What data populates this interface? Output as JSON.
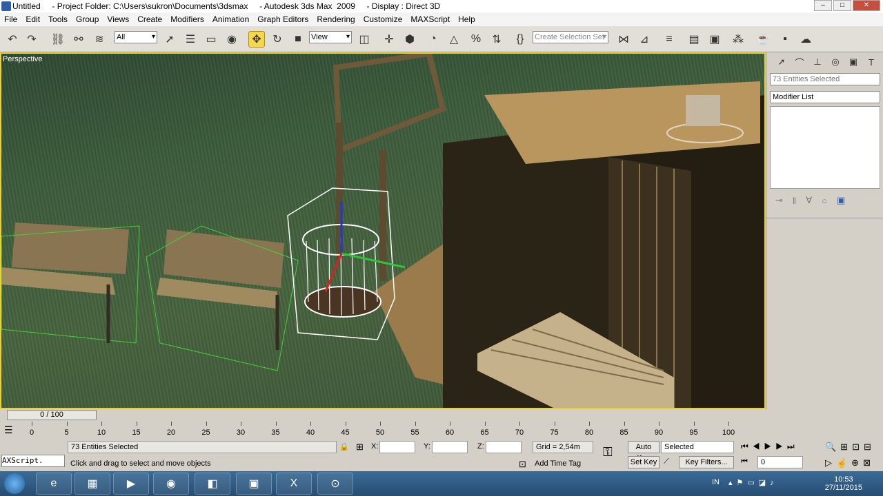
{
  "window": {
    "title": "Untitled     - Project Folder: C:\\Users\\sukron\\Documents\\3dsmax     - Autodesk 3ds Max  2009     - Display : Direct 3D"
  },
  "menu": [
    "File",
    "Edit",
    "Tools",
    "Group",
    "Views",
    "Create",
    "Modifiers",
    "Animation",
    "Graph Editors",
    "Rendering",
    "Customize",
    "MAXScript",
    "Help"
  ],
  "toolbar": {
    "filter_value": "All",
    "refcoord_value": "View",
    "selection_set_placeholder": "Create Selection Set"
  },
  "viewport": {
    "label": "Perspective"
  },
  "command_panel": {
    "selection_info": "73 Entities Selected",
    "modifier_list": "Modifier List"
  },
  "time": {
    "slider": "0 / 100",
    "ticks": [
      "0",
      "5",
      "10",
      "15",
      "20",
      "25",
      "30",
      "35",
      "40",
      "45",
      "50",
      "55",
      "60",
      "65",
      "70",
      "75",
      "80",
      "85",
      "90",
      "95",
      "100"
    ]
  },
  "status": {
    "maxscript": "AXScript.",
    "selected_count": "73 Entities Selected",
    "prompt": "Click and drag to select and move objects",
    "x_label": "X:",
    "y_label": "Y:",
    "z_label": "Z:",
    "grid": "Grid = 2,54m",
    "add_time_tag": "Add Time Tag",
    "auto_key": "Auto Key",
    "set_key": "Set Key",
    "key_mode": "Selected",
    "key_filters": "Key Filters...",
    "frame": "0"
  },
  "taskbar": {
    "lang": "IN",
    "time": "10:53",
    "date": "27/11/2015"
  },
  "colors": {
    "active_viewport_border": "#e8d23c",
    "selection_green": "#3fd33a"
  }
}
